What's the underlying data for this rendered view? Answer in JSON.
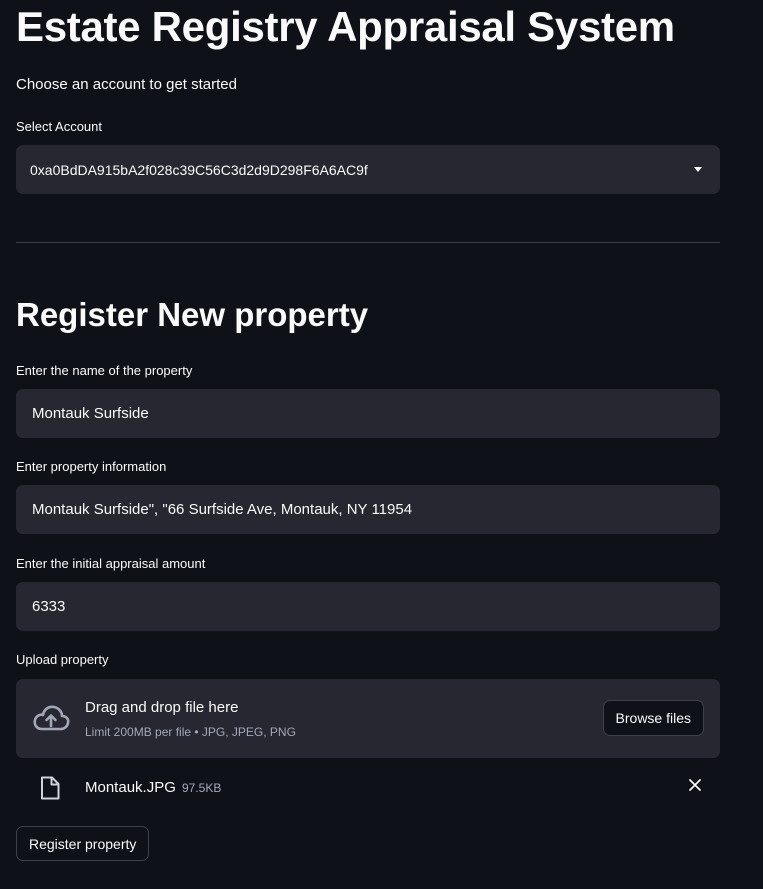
{
  "app": {
    "title": "Estate Registry Appraisal System",
    "subtitle": "Choose an account to get started"
  },
  "account": {
    "label": "Select Account",
    "selected": "0xa0BdDA915bA2f028c39C56C3d2d9D298F6A6AC9f"
  },
  "register": {
    "heading": "Register New property",
    "name_label": "Enter the name of the property",
    "name_value": "Montauk Surfside",
    "info_label": "Enter property information",
    "info_value": "Montauk Surfside\", \"66 Surfside Ave, Montauk, NY 11954",
    "appraisal_label": "Enter the initial appraisal amount",
    "appraisal_value": "6333",
    "upload_label": "Upload property",
    "upload": {
      "drop_text": "Drag and drop file here",
      "limit_text": "Limit 200MB per file • JPG, JPEG, PNG",
      "browse_label": "Browse files",
      "icon": "cloud-upload-icon"
    },
    "file": {
      "name": "Montauk.JPG",
      "size": "97.5KB",
      "icon": "file-icon"
    },
    "submit_label": "Register property"
  },
  "colors": {
    "background": "#0e1117",
    "input_bg": "#262730",
    "text": "#fafafa",
    "muted": "#a3a8b8"
  }
}
